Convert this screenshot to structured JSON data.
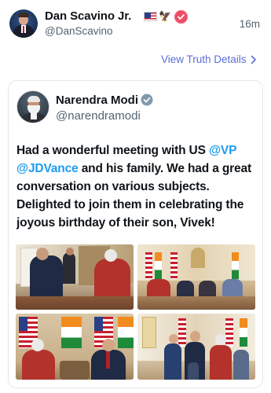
{
  "post": {
    "author_name": "Dan Scavino Jr.",
    "author_handle": "@DanScavino",
    "time": "16m",
    "badges": [
      "us-flag-emoji",
      "eagle-emoji",
      "verified-badge"
    ],
    "view_details_label": "View Truth Details"
  },
  "quoted": {
    "author_name": "Narendra Modi",
    "author_handle": "@narendramodi",
    "text_parts": {
      "t1": "Had a wonderful meeting with US ",
      "m1": "@VP",
      "t2": " ",
      "m2": "@JDVance",
      "t3": " and his family. We had a great conversation on various subjects. Delighted to join them in celebrating the joyous birthday of their son, Vivek!"
    },
    "photos": [
      {
        "name": "photo-1"
      },
      {
        "name": "photo-2"
      },
      {
        "name": "photo-3"
      },
      {
        "name": "photo-4"
      }
    ]
  },
  "colors": {
    "link": "#1d9bf0",
    "details_link": "#5b6fd6",
    "verified_red": "#ec4c68",
    "verified_blue": "#1d9bf0",
    "muted_text": "#536471"
  }
}
